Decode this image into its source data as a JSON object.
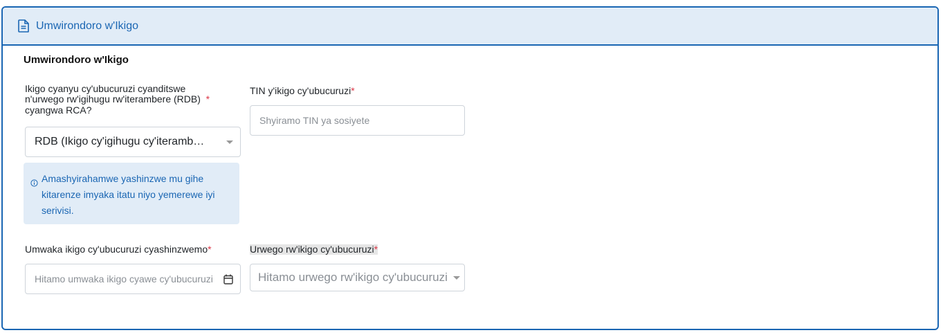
{
  "header": {
    "title": "Umwirondoro w'Ikigo",
    "icon": "document-icon"
  },
  "section": {
    "title": "Umwirondoro w'Ikigo"
  },
  "form": {
    "rdb_question": {
      "label_line1": "Ikigo cyanyu cy'ubucuruzi cyanditswe",
      "label_line2": "n'urwego rw'igihugu rw'iterambere (RDB)",
      "label_line3": "cyangwa RCA?",
      "required_mark": "*",
      "selected_value": "RDB (Ikigo cy'igihugu cy'iteramb…"
    },
    "tin": {
      "label": "TIN y'ikigo cy'ubucuruzi",
      "required_mark": "*",
      "placeholder": "Shyiramo TIN ya sosiyete"
    },
    "info_message": "Amashyirahamwe yashinzwe mu gihe kitarenze imyaka itatu niyo yemerewe iyi serivisi.",
    "year_founded": {
      "label": "Umwaka ikigo cy'ubucuruzi cyashinzwemo",
      "required_mark": "*",
      "placeholder": "Hitamo umwaka ikigo cyawe cy'ubucuruzi"
    },
    "business_level": {
      "label": "Urwego rw'ikigo cy'ubucuruzi",
      "required_mark": "*",
      "placeholder": "Hitamo urwego rw'ikigo cy'ubucuruzi"
    }
  },
  "colors": {
    "accent": "#1a66b3",
    "header_bg": "#e1ecf7",
    "required": "#dc3545"
  }
}
